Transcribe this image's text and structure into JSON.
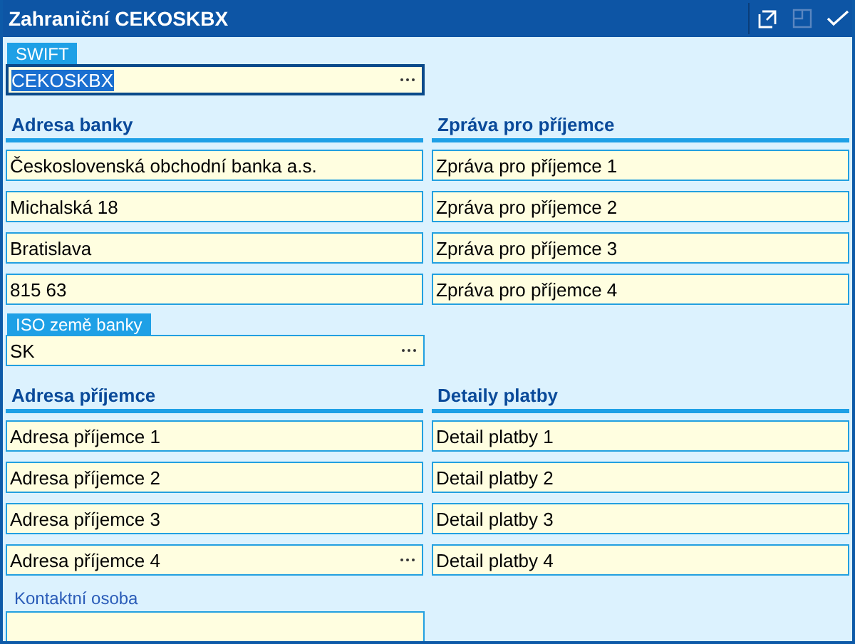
{
  "window": {
    "title": "Zahraniční CEKOSKBX"
  },
  "swift": {
    "label": "SWIFT",
    "kind": "tab",
    "value": "CEKOSKBX",
    "focused": true,
    "has_lookup": true
  },
  "bank_address": {
    "heading": "Adresa banky",
    "fields": [
      {
        "value": "Československá obchodní banka a.s.",
        "has_lookup": false
      },
      {
        "value": "Michalská 18",
        "has_lookup": false
      },
      {
        "value": "Bratislava",
        "has_lookup": false
      },
      {
        "value": "815 63",
        "has_lookup": false
      }
    ]
  },
  "recipient_message": {
    "heading": "Zpráva pro příjemce",
    "fields": [
      {
        "value": "Zpráva pro příjemce 1",
        "has_lookup": false
      },
      {
        "value": "Zpráva pro příjemce 2",
        "has_lookup": false
      },
      {
        "value": "Zpráva pro příjemce 3",
        "has_lookup": false
      },
      {
        "value": "Zpráva pro příjemce 4",
        "has_lookup": false
      }
    ]
  },
  "iso_country": {
    "label": "ISO země banky",
    "kind": "tab",
    "value": "SK",
    "focused": false,
    "has_lookup": true
  },
  "recipient_address": {
    "heading": "Adresa příjemce",
    "fields": [
      {
        "value": "Adresa příjemce 1",
        "has_lookup": false
      },
      {
        "value": "Adresa příjemce 2",
        "has_lookup": false
      },
      {
        "value": "Adresa příjemce 3",
        "has_lookup": false
      },
      {
        "value": "Adresa příjemce 4",
        "has_lookup": true
      }
    ]
  },
  "payment_details": {
    "heading": "Detaily platby",
    "fields": [
      {
        "value": "Detail platby 1",
        "has_lookup": false
      },
      {
        "value": "Detail platby 2",
        "has_lookup": false
      },
      {
        "value": "Detail platby 3",
        "has_lookup": false
      },
      {
        "value": "Detail platby 4",
        "has_lookup": false
      }
    ]
  },
  "contact": {
    "label": "Kontaktní osoba",
    "kind": "plain",
    "focused": false,
    "has_lookup": false
  }
}
